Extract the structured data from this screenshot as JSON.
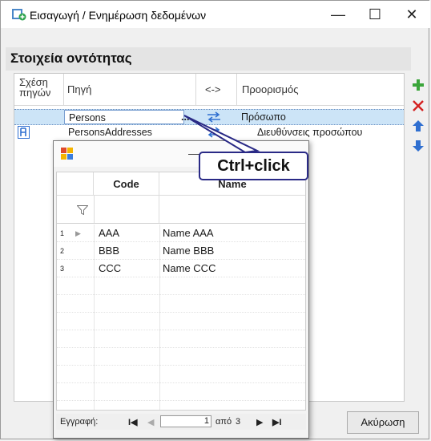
{
  "window": {
    "title": "Εισαγωγή / Ενημέρωση δεδομένων",
    "minimize_glyph": "—",
    "maximize_glyph": "☐",
    "close_glyph": "✕"
  },
  "section": {
    "title": "Στοιχεία οντότητας"
  },
  "grid": {
    "columns": {
      "relation": "Σχέση πηγών",
      "source": "Πηγή",
      "arrow": "<->",
      "destination": "Προορισμός"
    },
    "rows": [
      {
        "source": "Persons",
        "ellipsis": "...",
        "destination": "Πρόσωπο",
        "selected": true
      },
      {
        "source": "PersonsAddresses",
        "ellipsis": "",
        "destination": "Διευθύνσεις προσώπου",
        "selected": false
      }
    ]
  },
  "tools": [
    "add-icon",
    "delete-icon",
    "move-up-icon",
    "move-down-icon"
  ],
  "popup": {
    "columns": {
      "code": "Code",
      "name": "Name"
    },
    "rows": [
      {
        "num": "1",
        "code": "AAA",
        "name": "Name AAA"
      },
      {
        "num": "2",
        "code": "BBB",
        "name": "Name BBB"
      },
      {
        "num": "3",
        "code": "CCC",
        "name": "Name CCC"
      }
    ],
    "nav": {
      "record_label": "Εγγραφή:",
      "first": "I◀",
      "current": "1",
      "of_label": "από",
      "total": "3",
      "next": "▶",
      "last": "▶I"
    }
  },
  "callout": {
    "text": "Ctrl+click"
  },
  "buttons": {
    "cancel": "Ακύρωση"
  },
  "colors": {
    "accent": "#2a2a86",
    "selection": "#cce4f7",
    "add": "#3aa53a",
    "delete": "#d42020",
    "arrow": "#2f6fd0"
  }
}
